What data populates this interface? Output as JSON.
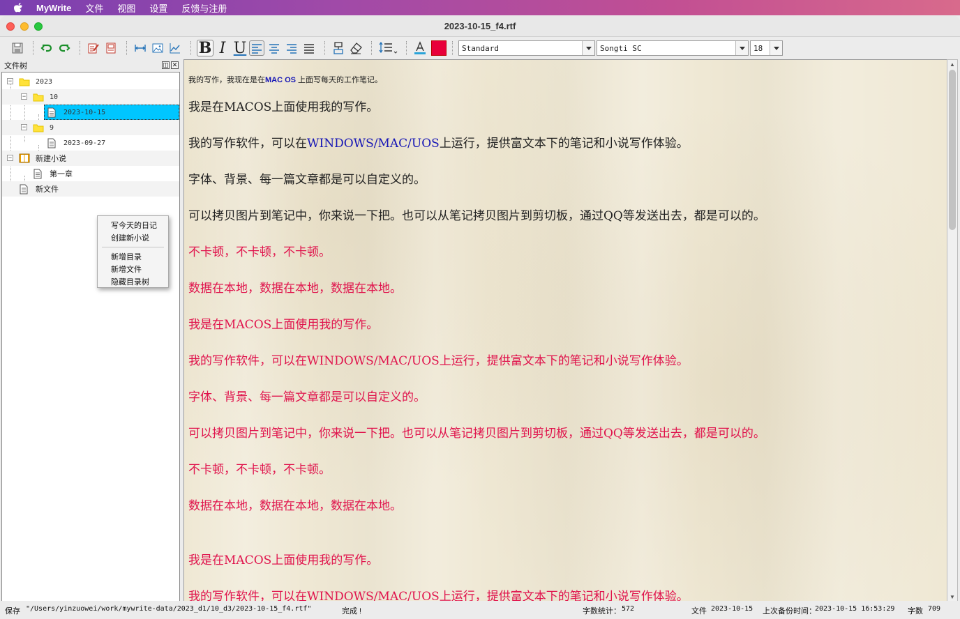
{
  "menubar": {
    "app_name": "MyWrite",
    "items": [
      "文件",
      "视图",
      "设置",
      "反馈与注册"
    ]
  },
  "window": {
    "title": "2023-10-15_f4.rtf"
  },
  "toolbar": {
    "style_combo": "Standard",
    "font_combo": "Songti SC",
    "size_combo": "18",
    "text_color": "#e8003a"
  },
  "tree_panel": {
    "title": "文件树",
    "items": [
      {
        "label": "2023",
        "type": "folder"
      },
      {
        "label": "10",
        "type": "folder"
      },
      {
        "label": "2023-10-15",
        "type": "file",
        "selected": true
      },
      {
        "label": "9",
        "type": "folder"
      },
      {
        "label": "2023-09-27",
        "type": "file"
      },
      {
        "label": "新建小说",
        "type": "book"
      },
      {
        "label": "第一章",
        "type": "file"
      },
      {
        "label": "新文件",
        "type": "file"
      }
    ]
  },
  "context_menu": {
    "items": [
      "写今天的日记",
      "创建新小说",
      "新增目录",
      "新增文件",
      "隐藏目录树"
    ]
  },
  "editor": {
    "intro": {
      "before": "我的写作，我现在是在",
      "highlight": "MAC OS",
      "after": " 上面写每天的工作笔记。"
    },
    "paragraphs": [
      {
        "text": "我是在MACOS上面使用我的写作。",
        "color": "black"
      },
      {
        "before": "我的写作软件，可以在",
        "highlight": "WINDOWS/MAC/UOS",
        "after": "上运行，提供富文本下的笔记和小说写作体验。",
        "color": "black"
      },
      {
        "text": "字体、背景、每一篇文章都是可以自定义的。",
        "color": "black"
      },
      {
        "text": "可以拷贝图片到笔记中，你来说一下把。也可以从笔记拷贝图片到剪切板，通过QQ等发送出去，都是可以的。",
        "color": "black"
      },
      {
        "text": "不卡顿，不卡顿，不卡顿。",
        "color": "red"
      },
      {
        "text": "数据在本地，数据在本地，数据在本地。",
        "color": "red"
      },
      {
        "text": "我是在MACOS上面使用我的写作。",
        "color": "red"
      },
      {
        "text": "我的写作软件，可以在WINDOWS/MAC/UOS上运行，提供富文本下的笔记和小说写作体验。",
        "color": "red"
      },
      {
        "text": "字体、背景、每一篇文章都是可以自定义的。",
        "color": "red"
      },
      {
        "text": "可以拷贝图片到笔记中，你来说一下把。也可以从笔记拷贝图片到剪切板，通过QQ等发送出去，都是可以的。",
        "color": "red"
      },
      {
        "text": "不卡顿，不卡顿，不卡顿。",
        "color": "red"
      },
      {
        "text": "数据在本地，数据在本地，数据在本地。",
        "color": "red"
      },
      {
        "text": "我是在MACOS上面使用我的写作。",
        "color": "red"
      },
      {
        "text": "我的写作软件，可以在WINDOWS/MAC/UOS上运行，提供富文本下的笔记和小说写作体验。",
        "color": "red"
      }
    ]
  },
  "statusbar": {
    "save_label": "保存",
    "save_path": "\"/Users/yinzuowei/work/mywrite-data/2023_d1/10_d3/2023-10-15_f4.rtf\"",
    "save_status": "完成 !",
    "wordcount_label": "字数统计：",
    "wordcount_value": "572",
    "file_label": "文件",
    "file_value": "2023-10-15",
    "backup_label": "上次备份时间：",
    "backup_value": "2023-10-15 16:53:29",
    "chars_label": "字数",
    "chars_value": "709"
  }
}
